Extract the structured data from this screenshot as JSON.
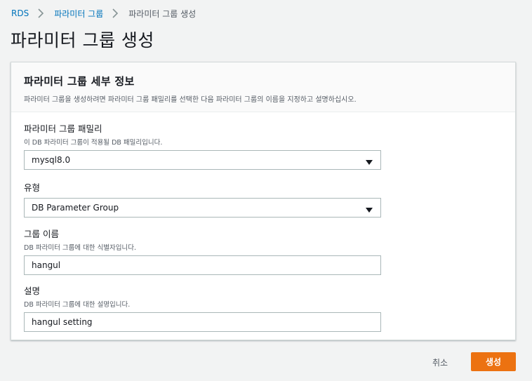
{
  "breadcrumb": {
    "items": [
      "RDS",
      "파라미터 그룹",
      "파라미터 그룹 생성"
    ]
  },
  "page": {
    "title": "파라미터 그룹 생성"
  },
  "panel": {
    "title": "파라미터 그룹 세부 정보",
    "description": "파라미터 그룹을 생성하려면 파라미터 그룹 패밀리를 선택한 다음 파라미터 그룹의 이름을 지정하고 설명하십시오."
  },
  "fields": {
    "family": {
      "label": "파라미터 그룹 패밀리",
      "description": "이 DB 파라미터 그룹이 적용될 DB 패밀리입니다.",
      "value": "mysql8.0"
    },
    "type": {
      "label": "유형",
      "value": "DB Parameter Group"
    },
    "name": {
      "label": "그룹 이름",
      "description": "DB 파라미터 그룹에 대한 식별자입니다.",
      "value": "hangul"
    },
    "desc": {
      "label": "설명",
      "description": "DB 파라미터 그룹에 대한 설명입니다.",
      "value": "hangul setting"
    }
  },
  "actions": {
    "cancel_label": "취소",
    "create_label": "생성"
  },
  "colors": {
    "link": "#0073bb",
    "primary_button": "#ec7211",
    "background": "#f2f3f3"
  },
  "icons": {
    "breadcrumb_separator": "chevron-right-icon",
    "select_caret": "caret-down-icon"
  }
}
